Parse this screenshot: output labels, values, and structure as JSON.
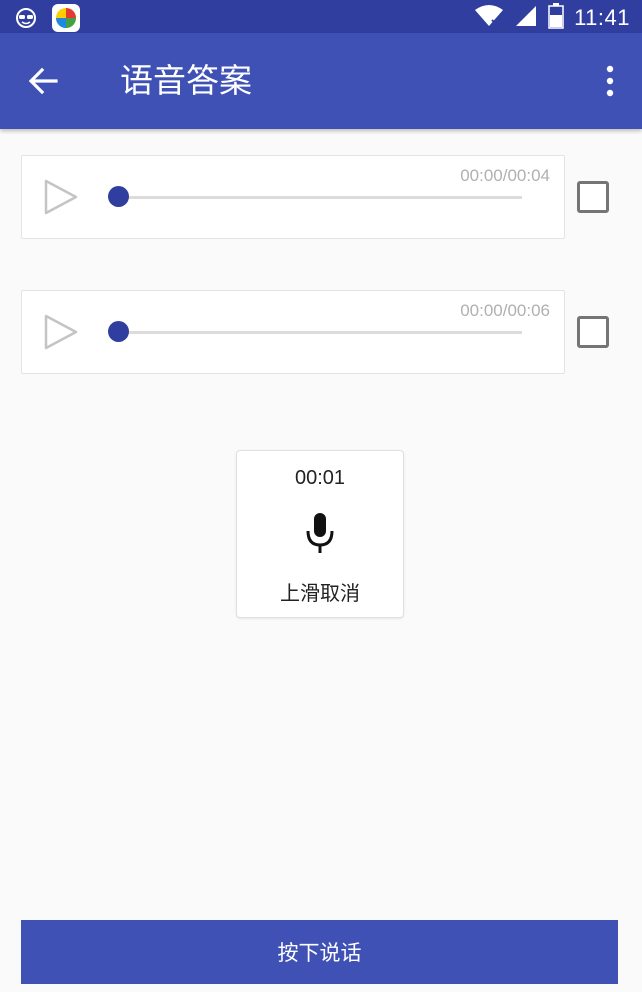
{
  "status_bar": {
    "time": "11:41",
    "icons": [
      "glasses-icon",
      "app-store-icon",
      "wifi-icon",
      "signal-icon",
      "battery-icon"
    ]
  },
  "app_bar": {
    "title": "语音答案",
    "back_icon": "arrow-left-icon",
    "menu_icon": "more-vert-icon",
    "color": "#3f51b5"
  },
  "recordings": [
    {
      "time_text": "00:00/00:04",
      "progress": 0,
      "checked": false
    },
    {
      "time_text": "00:00/00:06",
      "progress": 0,
      "checked": false
    }
  ],
  "recording_popup": {
    "elapsed": "00:01",
    "hint": "上滑取消",
    "icon": "microphone-icon"
  },
  "talk_button": {
    "label": "按下说话"
  },
  "colors": {
    "primary": "#3f51b5",
    "primary_dark": "#303f9f",
    "background": "#fafafa"
  }
}
